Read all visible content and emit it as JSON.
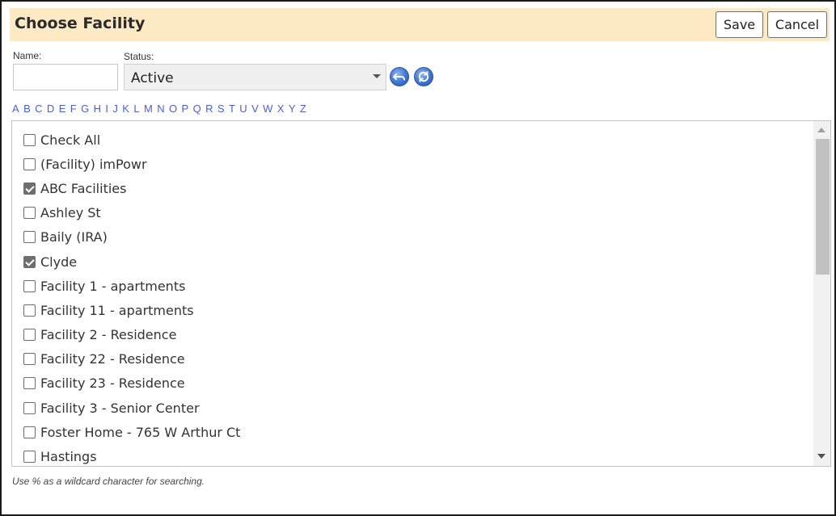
{
  "dialog": {
    "title": "Choose Facility",
    "save_label": "Save",
    "cancel_label": "Cancel"
  },
  "filters": {
    "name_label": "Name:",
    "name_value": "",
    "status_label": "Status:",
    "status_value": "Active",
    "undo_icon": "undo-icon",
    "refresh_icon": "refresh-icon"
  },
  "alphabet": [
    "A",
    "B",
    "C",
    "D",
    "E",
    "F",
    "G",
    "H",
    "I",
    "J",
    "K",
    "L",
    "M",
    "N",
    "O",
    "P",
    "Q",
    "R",
    "S",
    "T",
    "U",
    "V",
    "W",
    "X",
    "Y",
    "Z"
  ],
  "list": {
    "items": [
      {
        "label": "Check All",
        "checked": false
      },
      {
        "label": "(Facility) imPowr",
        "checked": false
      },
      {
        "label": "ABC Facilities",
        "checked": true
      },
      {
        "label": "Ashley St",
        "checked": false
      },
      {
        "label": "Baily (IRA)",
        "checked": false
      },
      {
        "label": "Clyde",
        "checked": true
      },
      {
        "label": "Facility 1 - apartments",
        "checked": false
      },
      {
        "label": "Facility 11 - apartments",
        "checked": false
      },
      {
        "label": "Facility 2 - Residence",
        "checked": false
      },
      {
        "label": "Facility 22 - Residence",
        "checked": false
      },
      {
        "label": "Facility 23 - Residence",
        "checked": false
      },
      {
        "label": "Facility 3 - Senior Center",
        "checked": false
      },
      {
        "label": "Foster Home - 765 W Arthur Ct",
        "checked": false
      },
      {
        "label": "Hastings",
        "checked": false
      }
    ]
  },
  "hint": "Use % as a wildcard character for searching.",
  "colors": {
    "header_bg": "#fde9c3",
    "link": "#4a5fd4",
    "checkbox_checked": "#6e6e6e"
  }
}
